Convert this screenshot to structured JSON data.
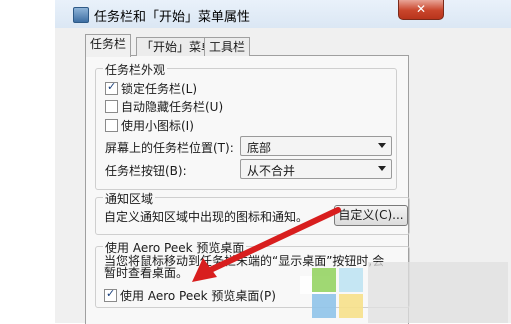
{
  "window": {
    "title": "任务栏和「开始」菜单属性",
    "close_label": "✕"
  },
  "tabs": [
    {
      "label": "任务栏",
      "active": true
    },
    {
      "label": "「开始」菜单",
      "active": false
    },
    {
      "label": "工具栏",
      "active": false
    }
  ],
  "appearance": {
    "group_label": "任务栏外观",
    "lock": {
      "label": "锁定任务栏(L)",
      "checked": true
    },
    "autohide": {
      "label": "自动隐藏任务栏(U)",
      "checked": false
    },
    "small_icons": {
      "label": "使用小图标(I)",
      "checked": false
    },
    "position_label": "屏幕上的任务栏位置(T):",
    "position_value": "底部",
    "buttons_label": "任务栏按钮(B):",
    "buttons_value": "从不合并"
  },
  "notification": {
    "group_label": "通知区域",
    "text": "自定义通知区域中出现的图标和通知。",
    "customize_button": "自定义(C)..."
  },
  "aero_peek": {
    "group_label": "使用 Aero Peek 预览桌面",
    "description": "当您将鼠标移动到任务栏末端的“显示桌面”按钮时,会暂时查看桌面。",
    "checkbox_label": "使用 Aero Peek 预览桌面(P)",
    "checked": true
  },
  "colors": {
    "arrow": "#d81e1e",
    "accent": "#3e6fa3"
  }
}
